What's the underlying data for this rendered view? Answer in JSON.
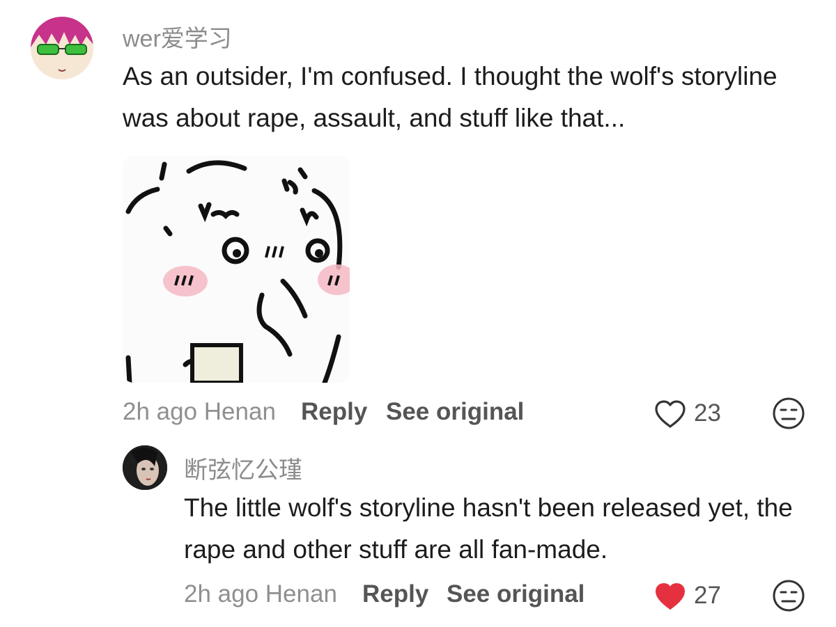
{
  "comments": [
    {
      "username": "wer爱学习",
      "text": "As an outsider, I'm confused. I thought the wolf's storyline was about rape, assault, and stuff like that...",
      "has_sticker": true,
      "sticker_icon": "blushing-cat-sticker",
      "time_location": "2h ago Henan",
      "reply_label": "Reply",
      "see_original_label": "See original",
      "likes": "23",
      "liked": false
    },
    {
      "username": "断弦忆公瑾",
      "text": "The little wolf's storyline hasn't been released yet, the rape and other stuff are all fan-made.",
      "time_location": "2h ago Henan",
      "reply_label": "Reply",
      "see_original_label": "See original",
      "likes": "27",
      "liked": true
    }
  ],
  "colors": {
    "liked_heart": "#e5313f",
    "muted_text": "#8f8f8f",
    "action_text": "#555555"
  }
}
